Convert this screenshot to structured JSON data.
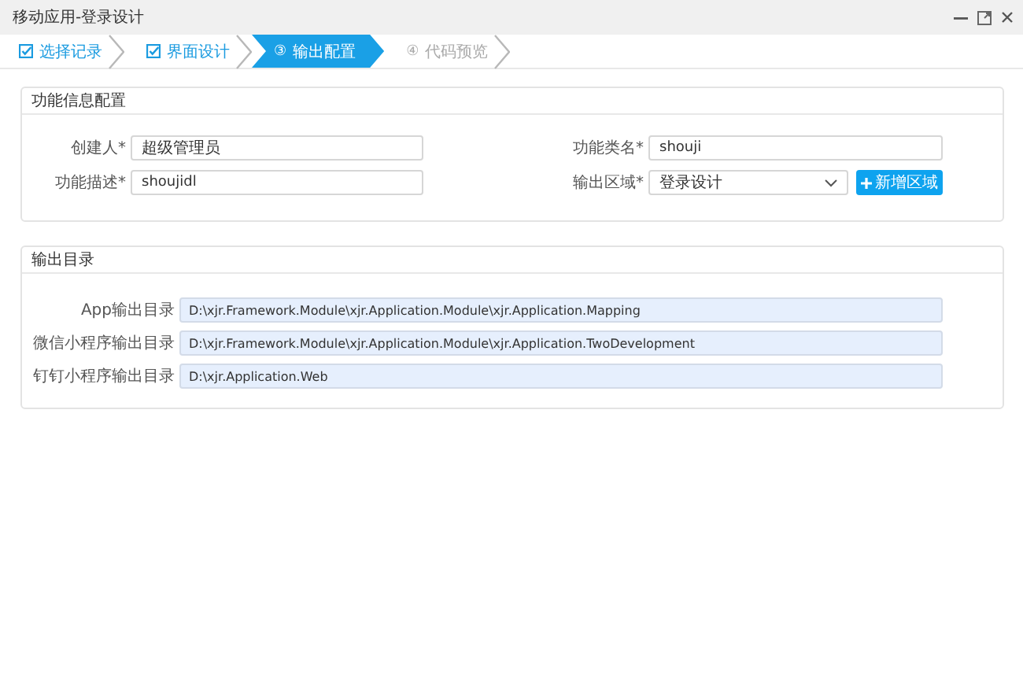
{
  "window": {
    "title": "移动应用-登录设计"
  },
  "steps": [
    {
      "label": "选择记录",
      "done": true,
      "selected": false
    },
    {
      "label": "界面设计",
      "done": true,
      "selected": false
    },
    {
      "label": "输出配置",
      "done": false,
      "selected": true,
      "number": "③"
    },
    {
      "label": "代码预览",
      "done": false,
      "selected": false,
      "number": "④"
    }
  ],
  "info_panel": {
    "title": "功能信息配置",
    "left_fields": [
      {
        "label": "创建人*",
        "value": "超级管理员"
      },
      {
        "label": "功能描述*",
        "value": "shoujidl"
      }
    ],
    "right_fields": [
      {
        "label": "功能类名*",
        "value": "shouji",
        "kind": "text"
      },
      {
        "label": "输出区域*",
        "value": "登录设计",
        "kind": "select"
      }
    ],
    "add_button": "新增区域"
  },
  "output_panel": {
    "title": "输出目录",
    "rows": [
      {
        "label": "App输出目录",
        "value": "D:\\xjr.Framework.Module\\xjr.Application.Module\\xjr.Application.Mapping"
      },
      {
        "label": "微信小程序输出目录",
        "value": "D:\\xjr.Framework.Module\\xjr.Application.Module\\xjr.Application.TwoDevelopment"
      },
      {
        "label": "钉钉小程序输出目录",
        "value": "D:\\xjr.Application.Web"
      }
    ]
  }
}
